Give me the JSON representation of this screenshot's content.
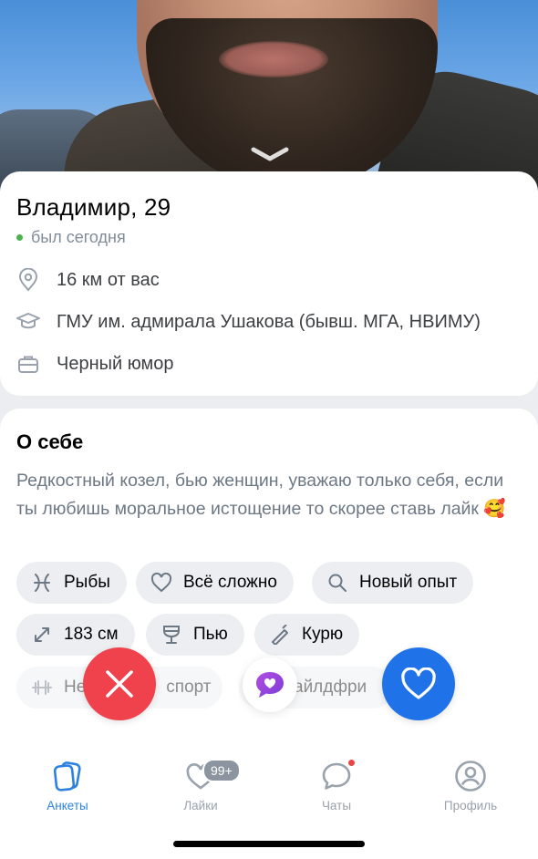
{
  "profile": {
    "name_age": "Владимир, 29",
    "status": "был сегодня",
    "distance": "16 км от вас",
    "education": "ГМУ им. адмирала Ушакова (бывш. МГА, НВИМУ)",
    "interest": "Черный юмор"
  },
  "about": {
    "title": "О себе",
    "text": "Редкостный козел, бью женщин, уважаю только себя, если ты любишь моральное истощение то скорее ставь лайк 🥰"
  },
  "chips": {
    "zodiac": "Рыбы",
    "relationship": "Всё сложно",
    "looking_for": "Новый опыт",
    "height": "183 см",
    "alcohol": "Пью",
    "smoking": "Курю",
    "sport": "Не занимаюсь спортом",
    "children": "Чайлдфри"
  },
  "chip_visible": {
    "sport_left": "Не",
    "sport_right": "спорт",
    "children_partial": "айлдфри"
  },
  "tabs": {
    "profiles": "Анкеты",
    "likes": "Лайки",
    "likes_badge": "99+",
    "chats": "Чаты",
    "profile": "Профиль"
  },
  "colors": {
    "accent": "#2d81e0",
    "dislike": "#f0424d",
    "like": "#1f72e8",
    "online": "#4bb34b"
  }
}
